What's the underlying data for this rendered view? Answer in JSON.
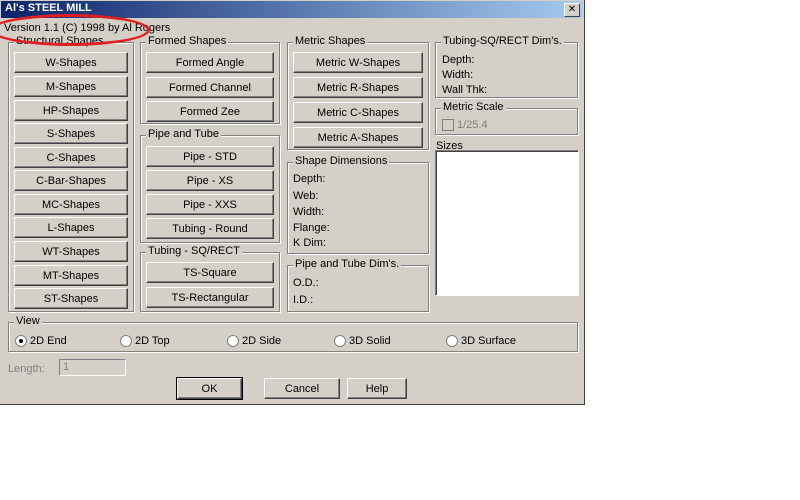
{
  "window": {
    "title": "Al's STEEL MILL",
    "close_glyph": "✕"
  },
  "version": "Version 1.1 (C) 1998 by Al Rogers",
  "structural": {
    "label": "Structural Shapes",
    "buttons": [
      "W-Shapes",
      "M-Shapes",
      "HP-Shapes",
      "S-Shapes",
      "C-Shapes",
      "C-Bar-Shapes",
      "MC-Shapes",
      "L-Shapes",
      "WT-Shapes",
      "MT-Shapes",
      "ST-Shapes"
    ]
  },
  "formed": {
    "label": "Formed Shapes",
    "buttons": [
      "Formed Angle",
      "Formed Channel",
      "Formed Zee"
    ]
  },
  "pipe": {
    "label": "Pipe and Tube",
    "buttons": [
      "Pipe - STD",
      "Pipe - XS",
      "Pipe - XXS",
      "Tubing - Round"
    ]
  },
  "tubing": {
    "label": "Tubing - SQ/RECT",
    "buttons": [
      "TS-Square",
      "TS-Rectangular"
    ]
  },
  "metric": {
    "label": "Metric Shapes",
    "buttons": [
      "Metric W-Shapes",
      "Metric R-Shapes",
      "Metric C-Shapes",
      "Metric A-Shapes"
    ]
  },
  "shape_dims": {
    "label": "Shape Dimensions",
    "fields": [
      "Depth:",
      "Web:",
      "Width:",
      "Flange:",
      "K Dim:"
    ]
  },
  "pipe_dims": {
    "label": "Pipe and Tube Dim's.",
    "fields": [
      "O.D.:",
      "I.D.:"
    ]
  },
  "tubing_dims": {
    "label": "Tubing-SQ/RECT Dim's.",
    "fields": [
      "Depth:",
      "Width:",
      "Wall Thk:"
    ]
  },
  "metric_scale": {
    "label": "Metric Scale",
    "checkbox_label": "1/25.4",
    "checked": false
  },
  "sizes": {
    "label": "Sizes"
  },
  "view": {
    "label": "View",
    "options": [
      "2D End",
      "2D Top",
      "2D Side",
      "3D Solid",
      "3D Surface"
    ],
    "selected": "2D End"
  },
  "length": {
    "label": "Length:",
    "value": "1"
  },
  "footer": {
    "ok": "OK",
    "cancel": "Cancel",
    "help": "Help"
  },
  "annotation_color": "#e02020"
}
